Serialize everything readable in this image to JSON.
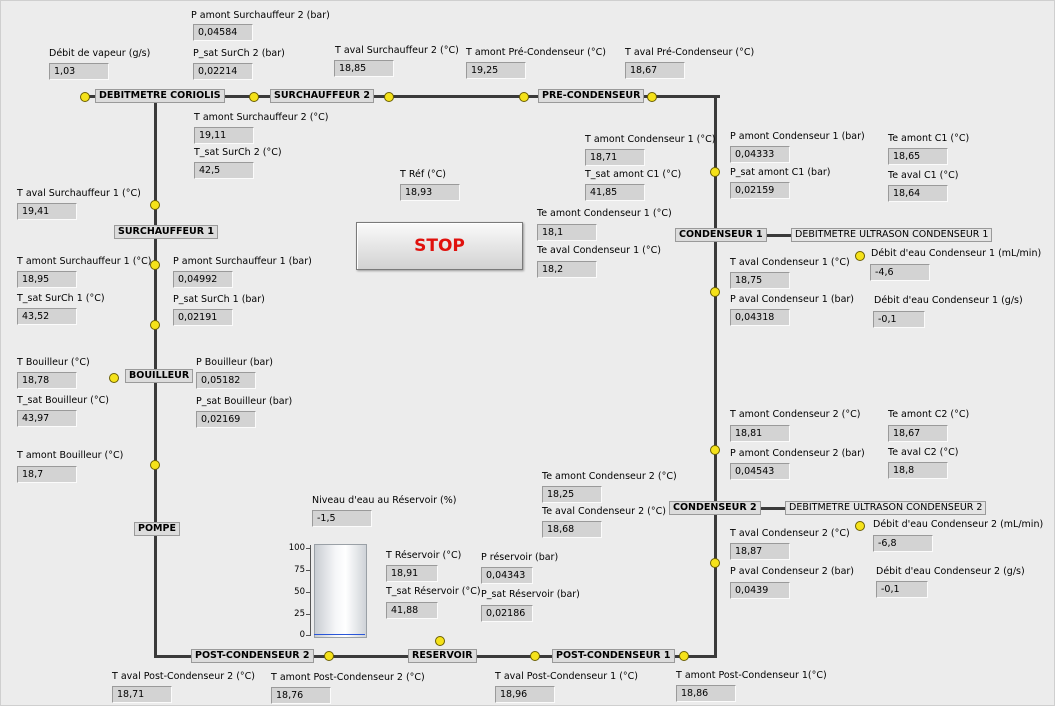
{
  "stop_button": {
    "label": "STOP",
    "color": "#e0110d"
  },
  "nodes": {
    "debitmetre_coriolis": "DEBITMETRE CORIOLIS",
    "surchauffeur2": "SURCHAUFFEUR 2",
    "pre_condenseur": "PRE-CONDENSEUR",
    "surchauffeur1": "SURCHAUFFEUR 1",
    "bouilleur": "BOUILLEUR",
    "pompe": "POMPE",
    "condenseur1": "CONDENSEUR 1",
    "condenseur2": "CONDENSEUR 2",
    "post_condenseur2": "POST-CONDENSEUR 2",
    "reservoir": "RESERVOIR",
    "post_condenseur1": "POST-CONDENSEUR 1",
    "debitmetre_ultrason_c1": "DEBITMETRE ULTRASON CONDENSEUR 1",
    "debitmetre_ultrason_c2": "DEBITMETRE ULTRASON CONDENSEUR 2"
  },
  "indicators": {
    "p_amont_surch2": {
      "label": "P amont Surchauffeur 2 (bar)",
      "value": "0,04584"
    },
    "p_sat_surch2": {
      "label": "P_sat SurCh 2 (bar)",
      "value": "0,02214"
    },
    "debit_vapeur": {
      "label": "Débit de vapeur (g/s)",
      "value": "1,03"
    },
    "t_aval_surch2": {
      "label": "T aval Surchauffeur 2 (°C)",
      "value": "18,85"
    },
    "t_amont_pre": {
      "label": "T amont Pré-Condenseur (°C)",
      "value": "19,25"
    },
    "t_aval_pre": {
      "label": "T aval Pré-Condenseur (°C)",
      "value": "18,67"
    },
    "t_amont_surch2": {
      "label": "T amont Surchauffeur 2 (°C)",
      "value": "19,11"
    },
    "t_sat_surch2": {
      "label": "T_sat SurCh 2 (°C)",
      "value": "42,5"
    },
    "t_ref": {
      "label": "T Réf (°C)",
      "value": "18,93"
    },
    "t_aval_surch1": {
      "label": "T aval Surchauffeur 1 (°C)",
      "value": "19,41"
    },
    "t_amont_surch1": {
      "label": "T amont Surchauffeur 1 (°C)",
      "value": "18,95"
    },
    "p_amont_surch1": {
      "label": "P amont Surchauffeur 1 (bar)",
      "value": "0,04992"
    },
    "t_sat_surch1": {
      "label": "T_sat SurCh 1 (°C)",
      "value": "43,52"
    },
    "p_sat_surch1": {
      "label": "P_sat SurCh 1 (bar)",
      "value": "0,02191"
    },
    "t_bouilleur": {
      "label": "T Bouilleur (°C)",
      "value": "18,78"
    },
    "p_bouilleur": {
      "label": "P Bouilleur (bar)",
      "value": "0,05182"
    },
    "t_sat_bouilleur": {
      "label": "T_sat Bouilleur (°C)",
      "value": "43,97"
    },
    "p_sat_bouilleur": {
      "label": "P_sat Bouilleur (bar)",
      "value": "0,02169"
    },
    "t_amont_bouilleur": {
      "label": "T amont Bouilleur (°C)",
      "value": "18,7"
    },
    "t_amont_c1": {
      "label": "T amont Condenseur 1 (°C)",
      "value": "18,71"
    },
    "t_sat_amont_c1": {
      "label": "T_sat amont C1 (°C)",
      "value": "41,85"
    },
    "p_amont_c1": {
      "label": "P amont Condenseur 1 (bar)",
      "value": "0,04333"
    },
    "p_sat_amont_c1": {
      "label": "P_sat amont C1 (bar)",
      "value": "0,02159"
    },
    "te_amont_c1_short": {
      "label": "Te amont C1 (°C)",
      "value": "18,65"
    },
    "te_aval_c1_short": {
      "label": "Te aval C1 (°C)",
      "value": "18,64"
    },
    "te_amont_c1": {
      "label": "Te amont Condenseur 1 (°C)",
      "value": "18,1"
    },
    "te_aval_c1": {
      "label": "Te aval Condenseur 1 (°C)",
      "value": "18,2"
    },
    "t_aval_c1": {
      "label": "T aval Condenseur 1 (°C)",
      "value": "18,75"
    },
    "p_aval_c1": {
      "label": "P aval Condenseur 1 (bar)",
      "value": "0,04318"
    },
    "debit_eau_c1_ml": {
      "label": "Débit d'eau Condenseur 1 (mL/min)",
      "value": "-4,6"
    },
    "debit_eau_c1_gs": {
      "label": "Débit d'eau Condenseur 1 (g/s)",
      "value": "-0,1"
    },
    "t_amont_c2": {
      "label": "T amont Condenseur 2 (°C)",
      "value": "18,81"
    },
    "p_amont_c2": {
      "label": "P amont Condenseur 2 (bar)",
      "value": "0,04543"
    },
    "te_amont_c2_short": {
      "label": "Te amont C2 (°C)",
      "value": "18,67"
    },
    "te_aval_c2_short": {
      "label": "Te aval C2 (°C)",
      "value": "18,8"
    },
    "te_amont_c2": {
      "label": "Te amont Condenseur 2 (°C)",
      "value": "18,25"
    },
    "te_aval_c2": {
      "label": "Te aval Condenseur 2 (°C)",
      "value": "18,68"
    },
    "t_aval_c2": {
      "label": "T aval Condenseur 2 (°C)",
      "value": "18,87"
    },
    "p_aval_c2": {
      "label": "P aval Condenseur 2 (bar)",
      "value": "0,0439"
    },
    "debit_eau_c2_ml": {
      "label": "Débit d'eau Condenseur 2 (mL/min)",
      "value": "-6,8"
    },
    "debit_eau_c2_gs": {
      "label": "Débit d'eau Condenseur 2 (g/s)",
      "value": "-0,1"
    },
    "niveau_reservoir": {
      "label": "Niveau d'eau au Réservoir (%)",
      "value": "-1,5"
    },
    "t_reservoir": {
      "label": "T Réservoir (°C)",
      "value": "18,91"
    },
    "t_sat_reservoir": {
      "label": "T_sat Réservoir (°C)",
      "value": "41,88"
    },
    "p_reservoir": {
      "label": "P réservoir (bar)",
      "value": "0,04343"
    },
    "p_sat_reservoir": {
      "label": "P_sat Réservoir (bar)",
      "value": "0,02186"
    },
    "t_aval_post2": {
      "label": "T aval Post-Condenseur 2 (°C)",
      "value": "18,71"
    },
    "t_amont_post2": {
      "label": "T amont Post-Condenseur 2 (°C)",
      "value": "18,76"
    },
    "t_aval_post1": {
      "label": "T aval Post-Condenseur 1 (°C)",
      "value": "18,96"
    },
    "t_amont_post1": {
      "label": "T amont Post-Condenseur 1(°C)",
      "value": "18,86"
    }
  },
  "tank": {
    "scale_ticks": [
      "100",
      "75",
      "50",
      "25",
      "0"
    ],
    "level_percent": -1.5,
    "fill_color": "#2a56d8"
  },
  "colors": {
    "background": "#ececec",
    "pipe": "#3a3a3a",
    "sensor_dot": "#f5e21a",
    "indicator_bg": "#d3d3d3"
  }
}
